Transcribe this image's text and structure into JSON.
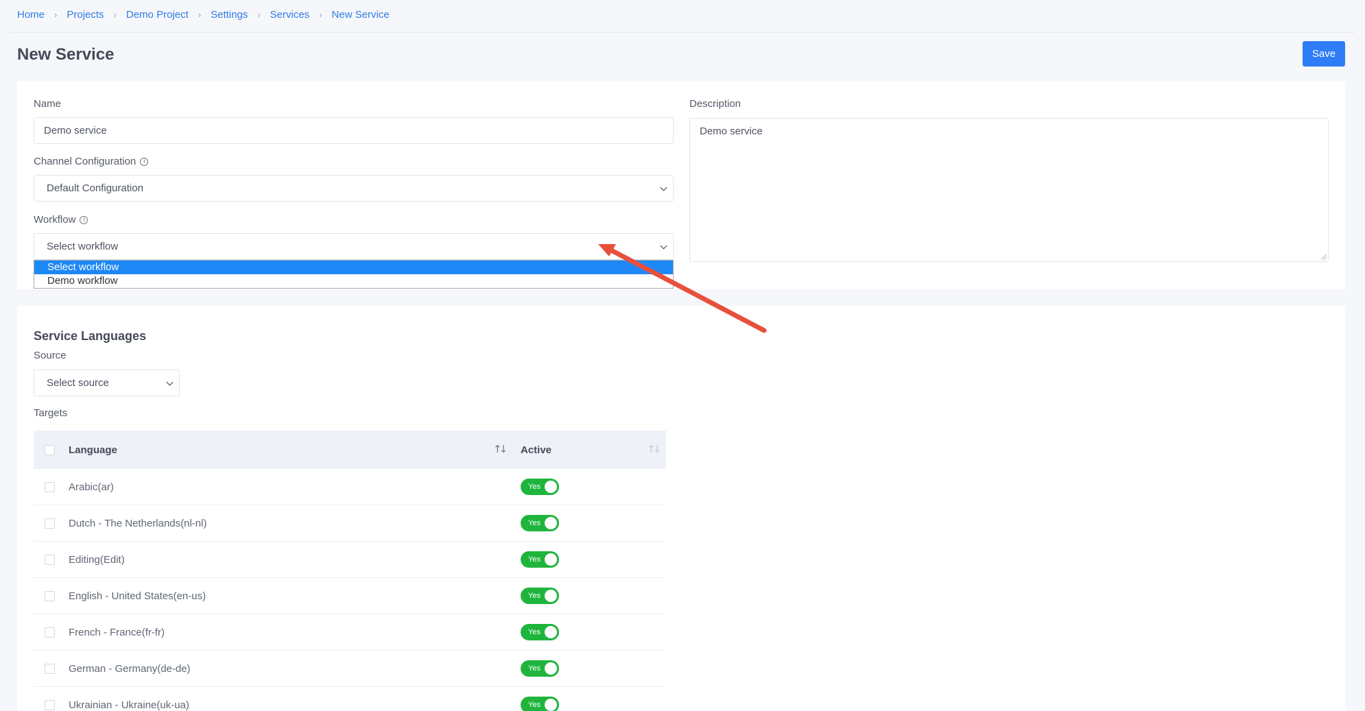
{
  "breadcrumb": [
    "Home",
    "Projects",
    "Demo Project",
    "Settings",
    "Services",
    "New Service"
  ],
  "page_title": "New Service",
  "save_label": "Save",
  "form": {
    "name_label": "Name",
    "name_value": "Demo service",
    "channel_label": "Channel Configuration",
    "channel_value": "Default Configuration",
    "workflow_label": "Workflow",
    "workflow_value": "Select workflow",
    "workflow_options": [
      "Select workflow",
      "Demo workflow"
    ],
    "description_label": "Description",
    "description_value": "Demo service"
  },
  "languages": {
    "title": "Service Languages",
    "source_label": "Source",
    "source_value": "Select source",
    "targets_label": "Targets",
    "columns": [
      "Language",
      "Active"
    ],
    "rows": [
      {
        "language": "Arabic(ar)",
        "active": "Yes"
      },
      {
        "language": "Dutch - The Netherlands(nl-nl)",
        "active": "Yes"
      },
      {
        "language": "Editing(Edit)",
        "active": "Yes"
      },
      {
        "language": "English - United States(en-us)",
        "active": "Yes"
      },
      {
        "language": "French - France(fr-fr)",
        "active": "Yes"
      },
      {
        "language": "German - Germany(de-de)",
        "active": "Yes"
      },
      {
        "language": "Ukrainian - Ukraine(uk-ua)",
        "active": "Yes"
      }
    ]
  },
  "colors": {
    "accent": "#2e7cf6",
    "toggle_on": "#1fb53c",
    "annotation_arrow": "#e8503c"
  }
}
